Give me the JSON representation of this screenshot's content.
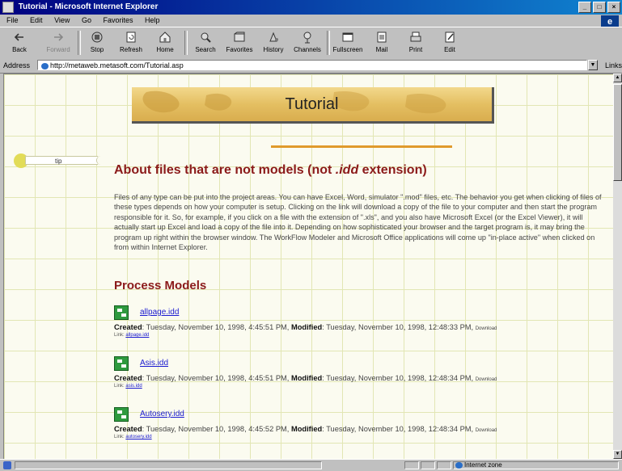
{
  "window": {
    "title": "Tutorial - Microsoft Internet Explorer",
    "buttons": [
      "_",
      "□",
      "×"
    ]
  },
  "menubar": {
    "items": [
      "File",
      "Edit",
      "View",
      "Go",
      "Favorites",
      "Help"
    ]
  },
  "toolbar": {
    "buttons": [
      {
        "label": "Back",
        "icon": "back-arrow-icon"
      },
      {
        "label": "Forward",
        "icon": "forward-arrow-icon"
      },
      {
        "label": "Stop",
        "icon": "stop-icon"
      },
      {
        "label": "Refresh",
        "icon": "refresh-icon"
      },
      {
        "label": "Home",
        "icon": "home-icon"
      },
      {
        "label": "Search",
        "icon": "search-icon"
      },
      {
        "label": "Favorites",
        "icon": "favorites-icon"
      },
      {
        "label": "History",
        "icon": "history-icon"
      },
      {
        "label": "Channels",
        "icon": "channels-icon"
      },
      {
        "label": "Fullscreen",
        "icon": "fullscreen-icon"
      },
      {
        "label": "Mail",
        "icon": "mail-icon"
      },
      {
        "label": "Print",
        "icon": "print-icon"
      },
      {
        "label": "Edit",
        "icon": "edit-icon"
      }
    ]
  },
  "address": {
    "label": "Address",
    "url": "http://metaweb.metasoft.com/Tutorial.asp",
    "links_label": "Links"
  },
  "page": {
    "banner_title": "Tutorial",
    "side_tab_label": "tip",
    "section_title_prefix": "About files that are not models (not ",
    "section_title_ext": ".idd",
    "section_title_suffix": " extension)",
    "body": "Files of any type can be put into the project areas. You can have Excel, Word, simulator \".mod\" files, etc. The behavior you get when clicking of files of these types depends on how your computer is setup. Clicking on the link will download a copy of the file to your computer and then start the program responsible for it. So, for example, if you click on a file with the extension of \".xls\", and you also have Microsoft Excel (or the Excel Viewer), it will actually start up Excel and load a copy of the file into it. Depending on how sophisticated your browser and the target program is, it may bring the program up right within the browser window. The WorkFlow Modeler and Microsoft Office applications will come up \"in-place active\" when clicked on from within Internet Explorer.",
    "models_title": "Process Models",
    "created_label": "Created",
    "modified_label": "Modified",
    "download_label": "Download",
    "link_label": "Link:",
    "models": [
      {
        "name": "allpage.idd",
        "created": "Tuesday, November 10, 1998, 4:45:51 PM",
        "modified": "Tuesday, November 10, 1998, 12:48:33 PM",
        "link": "allpage.idd"
      },
      {
        "name": "Asis.idd",
        "created": "Tuesday, November 10, 1998, 4:45:51 PM",
        "modified": "Tuesday, November 10, 1998, 12:48:34 PM",
        "link": "asis.idd"
      },
      {
        "name": "Autosery.idd",
        "created": "Tuesday, November 10, 1998, 4:45:52 PM",
        "modified": "Tuesday, November 10, 1998, 12:48:34 PM",
        "link": "autosery.idd"
      }
    ]
  },
  "status": {
    "zone": "Internet zone"
  }
}
